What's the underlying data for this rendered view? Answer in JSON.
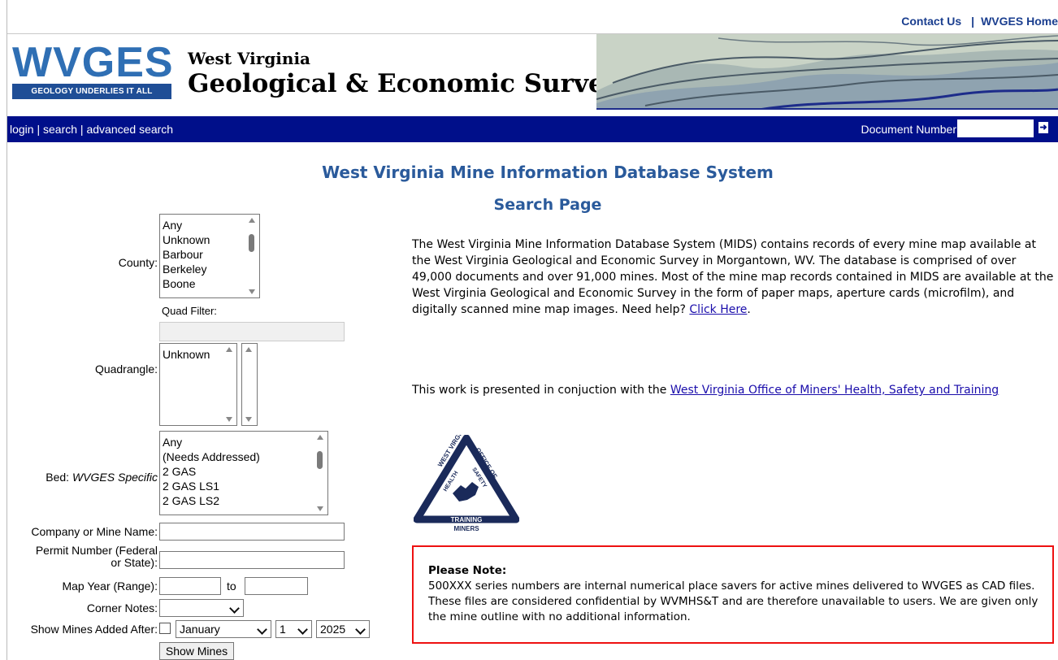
{
  "top": {
    "contact_label": "Contact Us",
    "separator": "|",
    "home_label": "WVGES Home"
  },
  "logo": {
    "letters": "WVGES",
    "tagline": "GEOLOGY UNDERLIES IT ALL"
  },
  "banner": {
    "line1": "West Virginia",
    "line2": "Geological & Economic Survey"
  },
  "nav": {
    "login": "login",
    "search": "search",
    "advanced": "advanced search",
    "sep": " | ",
    "document_number_label": "Document Number",
    "document_number_value": ""
  },
  "page": {
    "title": "West Virginia Mine Information Database System",
    "subtitle": "Search Page"
  },
  "form": {
    "county_label": "County:",
    "county_options": [
      "Any",
      "Unknown",
      "Barbour",
      "Berkeley",
      "Boone"
    ],
    "quad_filter_label": "Quad Filter:",
    "quad_filter_value": "",
    "quadrangle_label": "Quadrangle:",
    "quadrangle_options": [
      "Unknown"
    ],
    "bed_label": "Bed:",
    "bed_label_specific": "WVGES Specific",
    "bed_options": [
      "Any",
      "(Needs Addressed)",
      "2 GAS",
      "2 GAS LS1",
      "2 GAS LS2"
    ],
    "company_label": "Company or Mine Name:",
    "company_value": "",
    "permit_label_1": "Permit Number (Federal",
    "permit_label_2": "or State):",
    "permit_value": "",
    "map_year_label": "Map Year (Range):",
    "map_year_from": "",
    "map_year_to_label": "to",
    "map_year_to": "",
    "corner_notes_label": "Corner Notes:",
    "corner_notes_value": "",
    "show_added_label": "Show Mines Added After:",
    "month_value": "January",
    "day_value": "1",
    "year_value": "2025",
    "show_button": "Show Mines"
  },
  "info": {
    "paragraph1": "The West Virginia Mine Information Database System (MIDS) contains records of every mine map available at the West Virginia Geological and Economic Survey in Morgantown, WV. The database is comprised of over 49,000 documents and over 91,000 mines. Most of the mine map records contained in MIDS are available at the West Virginia Geological and Economic Survey in the form of paper maps, aperture cards (microfilm), and digitally scanned mine map images. Need help?",
    "help_link": "Click Here",
    "period": ".",
    "paragraph2_prefix": "This work is presented in conjuction with the ",
    "partner_link": "West Virginia Office of Miners' Health, Safety and Training",
    "seal_top": "WEST VIRGINIA",
    "seal_right": "OFFICE OF",
    "seal_left": "HEALTH",
    "seal_mid": "SAFETY",
    "seal_bottom1": "TRAINING",
    "seal_bottom2": "MINERS"
  },
  "note": {
    "heading": "Please Note:",
    "body": "500XXX series numbers are internal numerical place savers for active mines delivered to WVGES as CAD files. These files are considered confidential by WVMHS&T and are therefore unavailable to users. We are given only the mine outline with no additional information."
  },
  "colors": {
    "nav_bg": "#000f8a",
    "title_blue": "#2a5a9b",
    "link_blue": "#1a3e8f",
    "note_border": "#e11111"
  }
}
